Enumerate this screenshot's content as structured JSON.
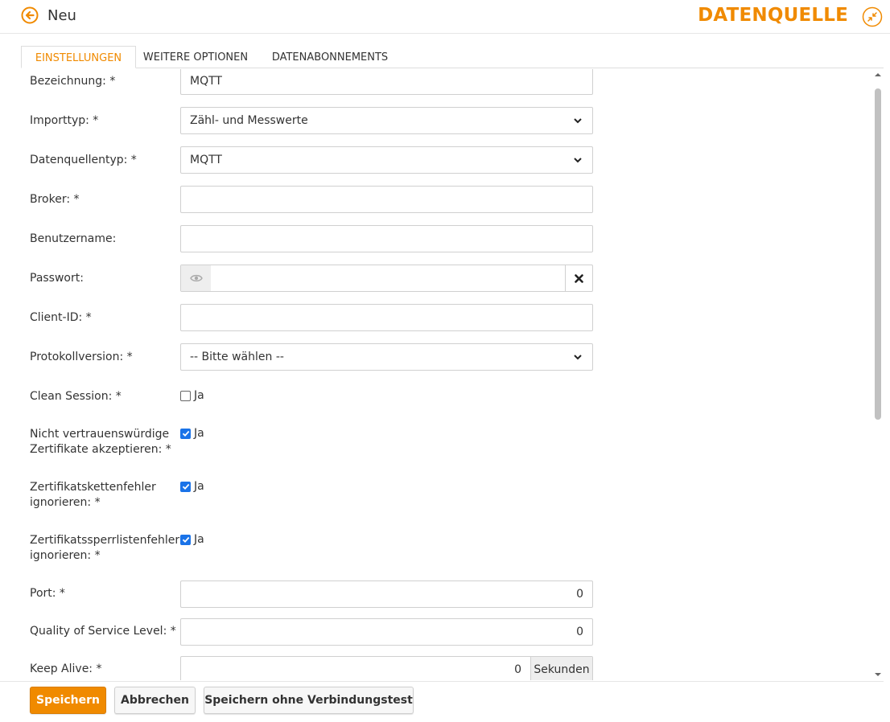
{
  "header": {
    "title": "Neu",
    "brand": "DATENQUELLE"
  },
  "tabs": [
    {
      "label": "EINSTELLUNGEN",
      "active": true
    },
    {
      "label": "WEITERE OPTIONEN",
      "active": false
    },
    {
      "label": "DATENABONNEMENTS",
      "active": false
    }
  ],
  "form": {
    "bezeichnung": {
      "label": "Bezeichnung: *",
      "value": "MQTT"
    },
    "importtyp": {
      "label": "Importtyp: *",
      "value": "Zähl- und Messwerte"
    },
    "datenquellentyp": {
      "label": "Datenquellentyp: *",
      "value": "MQTT"
    },
    "broker": {
      "label": "Broker: *",
      "value": ""
    },
    "benutzername": {
      "label": "Benutzername:",
      "value": ""
    },
    "passwort": {
      "label": "Passwort:",
      "value": ""
    },
    "client_id": {
      "label": "Client-ID: *",
      "value": ""
    },
    "protokollversion": {
      "label": "Protokollversion: *",
      "value": "-- Bitte wählen --"
    },
    "clean_session": {
      "label": "Clean Session: *",
      "option": "Ja",
      "checked": false
    },
    "untrusted_certs": {
      "label_line1": "Nicht vertrauenswürdige",
      "label_line2": "Zertifikate akzeptieren: *",
      "option": "Ja",
      "checked": true
    },
    "chain_errors": {
      "label_line1": "Zertifikatskettenfehler",
      "label_line2": "ignorieren: *",
      "option": "Ja",
      "checked": true
    },
    "revocation_errors": {
      "label_line1": "Zertifikatssperrlistenfehler",
      "label_line2": "ignorieren: *",
      "option": "Ja",
      "checked": true
    },
    "port": {
      "label": "Port: *",
      "value": "0"
    },
    "qos": {
      "label": "Quality of Service Level: *",
      "value": "0"
    },
    "keep_alive": {
      "label": "Keep Alive: *",
      "value": "0",
      "unit": "Sekunden"
    }
  },
  "footer": {
    "save": "Speichern",
    "cancel": "Abbrechen",
    "save_without_test": "Speichern ohne Verbindungstest"
  },
  "colors": {
    "accent": "#f08a00",
    "checkbox": "#1a73e8"
  },
  "icons": {
    "back": "arrow-left-circle-icon",
    "compress": "compress-icon",
    "eye": "eye-icon",
    "clear": "x-icon"
  }
}
